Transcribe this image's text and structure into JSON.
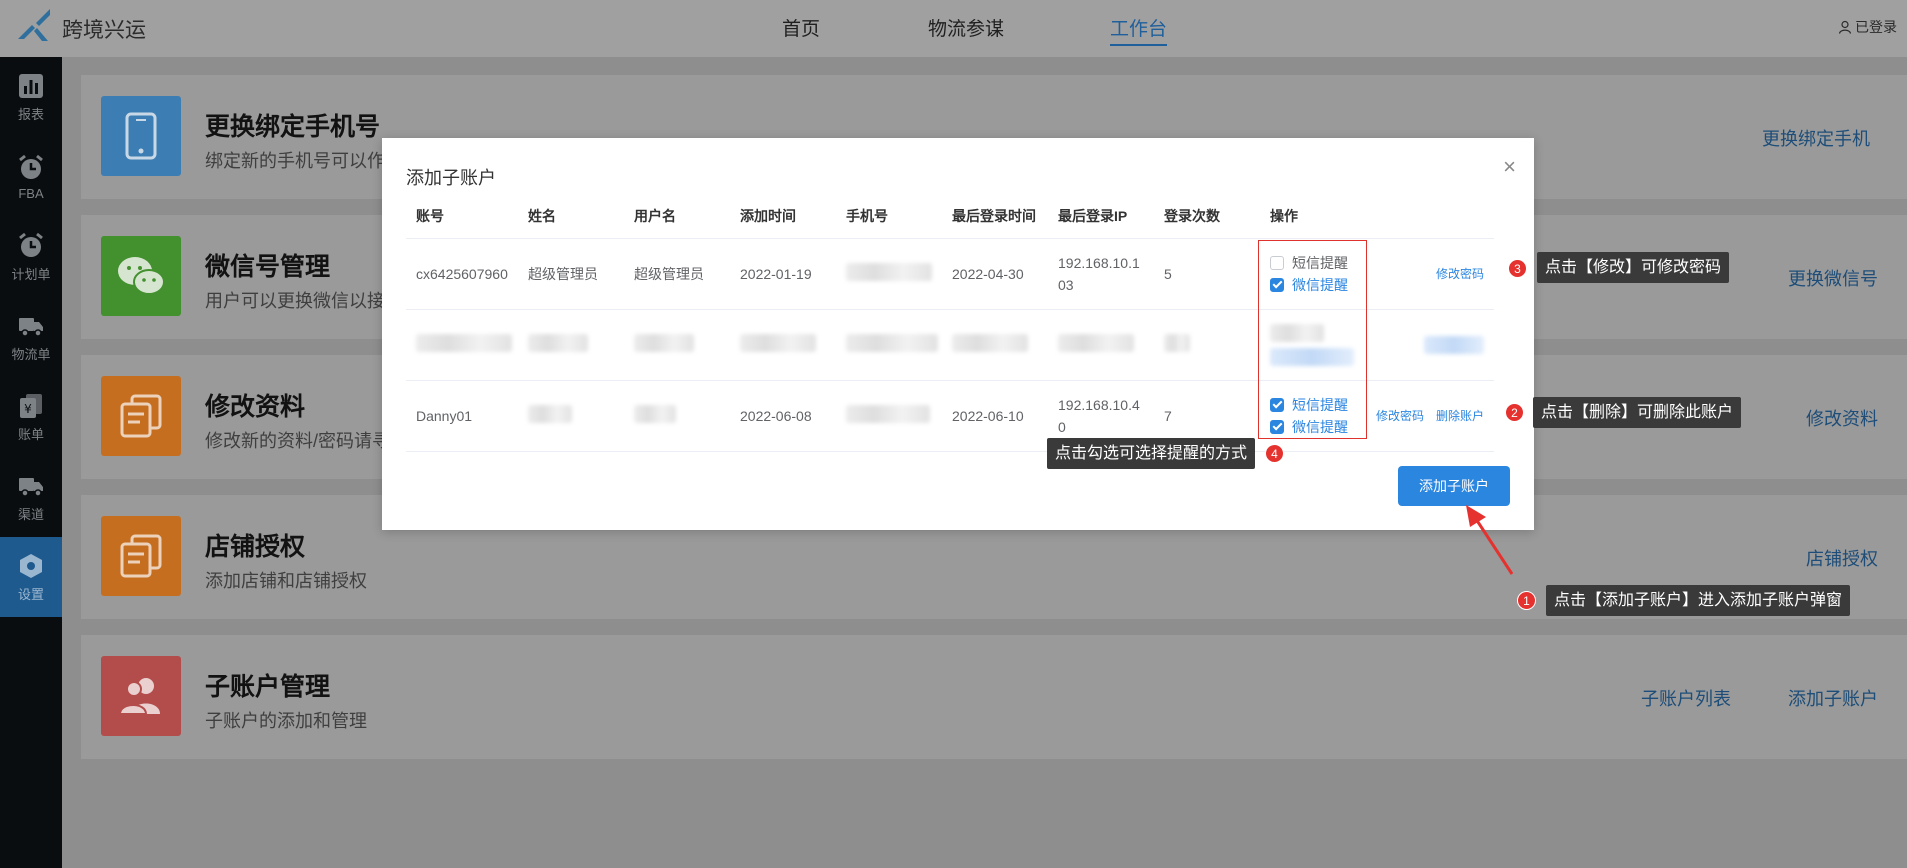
{
  "brand": {
    "name": "跨境兴运"
  },
  "nav": {
    "items": [
      {
        "label": "首页"
      },
      {
        "label": "物流参谋"
      },
      {
        "label": "工作台"
      }
    ],
    "login_state": "已登录"
  },
  "sidebar": {
    "items": [
      {
        "label": "报表",
        "icon": "bar-chart-icon"
      },
      {
        "label": "FBA",
        "icon": "alarm-clock-icon"
      },
      {
        "label": "计划单",
        "icon": "alarm-clock-icon"
      },
      {
        "label": "物流单",
        "icon": "truck-icon"
      },
      {
        "label": "账单",
        "icon": "yuan-docs-icon"
      },
      {
        "label": "渠道",
        "icon": "truck-icon"
      },
      {
        "label": "设置",
        "icon": "hexagon-gear-icon",
        "active": true
      }
    ]
  },
  "cards": [
    {
      "title": "更换绑定手机号",
      "desc": "绑定新的手机号可以作",
      "links": [
        "更换绑定手机"
      ],
      "color": "#3c7eb3"
    },
    {
      "title": "微信号管理",
      "desc": "用户可以更换微信以接",
      "links": [
        "更换微信号"
      ],
      "color": "#43902f"
    },
    {
      "title": "修改资料",
      "desc": "修改新的资料/密码请寻",
      "links": [
        "修改资料"
      ],
      "color": "#c66e1f"
    },
    {
      "title": "店铺授权",
      "desc": "添加店铺和店铺授权",
      "links": [
        "店铺授权"
      ],
      "color": "#c66e1f"
    },
    {
      "title": "子账户管理",
      "desc": "子账户的添加和管理",
      "links": [
        "子账户列表",
        "添加子账户"
      ],
      "color": "#b34d4b"
    }
  ],
  "modal": {
    "title": "添加子账户",
    "columns": [
      "账号",
      "姓名",
      "用户名",
      "添加时间",
      "手机号",
      "最后登录时间",
      "最后登录IP",
      "登录次数",
      "操作"
    ],
    "rows": [
      {
        "account": "cx6425607960",
        "name": "超级管理员",
        "username": "超级管理员",
        "added": "2022-01-19",
        "last_login": "2022-04-30",
        "ip_line1": "192.168.10.1",
        "ip_line2": "03",
        "count": "5",
        "sms_label": "短信提醒",
        "sms_checked": false,
        "wechat_label": "微信提醒",
        "wechat_checked": true,
        "actions": [
          "修改密码"
        ]
      },
      {
        "redacted": true
      },
      {
        "account": "Danny01",
        "added": "2022-06-08",
        "last_login": "2022-06-10",
        "ip_line1": "192.168.10.4",
        "ip_line2": "0",
        "count": "7",
        "sms_label": "短信提醒",
        "sms_checked": true,
        "wechat_label": "微信提醒",
        "wechat_checked": true,
        "actions": [
          "修改密码",
          "删除账户"
        ]
      }
    ],
    "add_button": "添加子账户"
  },
  "callouts": [
    {
      "badge": "1",
      "text": "点击【添加子账户】进入添加子账户弹窗"
    },
    {
      "badge": "2",
      "text": "点击【删除】可删除此账户"
    },
    {
      "badge": "3",
      "text": "点击【修改】可修改密码"
    },
    {
      "badge": "4",
      "text": "点击勾选可选择提醒的方式"
    }
  ],
  "colors": {
    "primary": "#2b86e0",
    "highlight_box": "#e0322c",
    "sidebar_active": "#1e5a8e"
  }
}
